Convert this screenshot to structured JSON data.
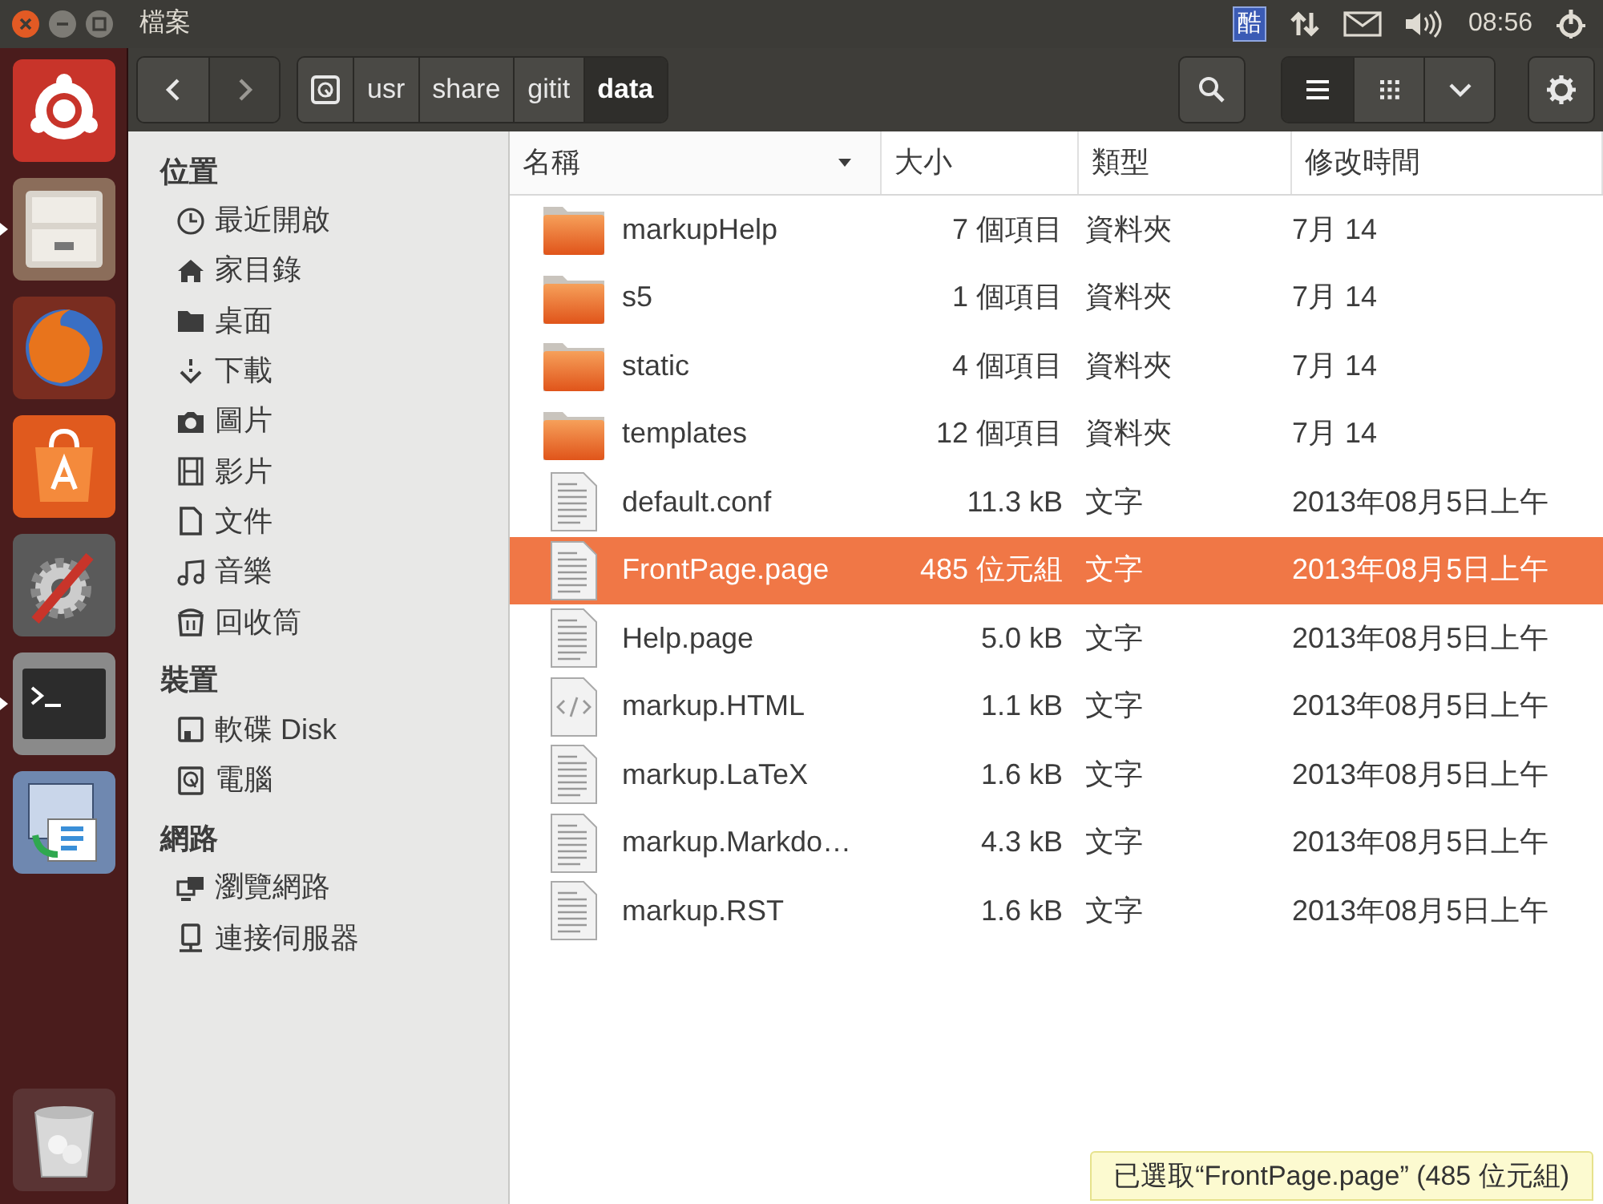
{
  "window": {
    "title": "檔案"
  },
  "indicators": {
    "keyboard": "酷",
    "time": "08:56"
  },
  "launcher": [
    {
      "running": false
    },
    {
      "running": true
    },
    {
      "running": false
    },
    {
      "running": false
    },
    {
      "running": false
    },
    {
      "running": true
    },
    {
      "running": false
    }
  ],
  "path": [
    {
      "label": "usr",
      "selected": false
    },
    {
      "label": "share",
      "selected": false
    },
    {
      "label": "gitit",
      "selected": false
    },
    {
      "label": "data",
      "selected": true
    }
  ],
  "sidebar": [
    {
      "heading": "位置",
      "items": [
        "最近開啟",
        "家目錄",
        "桌面",
        "下載",
        "圖片",
        "影片",
        "文件",
        "音樂",
        "回收筒"
      ]
    },
    {
      "heading": "裝置",
      "items": [
        "軟碟 Disk",
        "電腦"
      ]
    },
    {
      "heading": "網路",
      "items": [
        "瀏覽網路",
        "連接伺服器"
      ]
    }
  ],
  "columns": [
    {
      "label": "名稱",
      "sorted": true
    },
    {
      "label": "大小",
      "sorted": false
    },
    {
      "label": "類型",
      "sorted": false
    },
    {
      "label": "修改時間",
      "sorted": false
    }
  ],
  "rows": [
    {
      "kind": "folder",
      "name": "markupHelp",
      "size": "7 個項目",
      "type": "資料夾",
      "modified": "7月 14",
      "selected": false
    },
    {
      "kind": "folder",
      "name": "s5",
      "size": "1 個項目",
      "type": "資料夾",
      "modified": "7月 14",
      "selected": false
    },
    {
      "kind": "folder",
      "name": "static",
      "size": "4 個項目",
      "type": "資料夾",
      "modified": "7月 14",
      "selected": false
    },
    {
      "kind": "folder",
      "name": "templates",
      "size": "12 個項目",
      "type": "資料夾",
      "modified": "7月 14",
      "selected": false
    },
    {
      "kind": "text",
      "name": "default.conf",
      "size": "11.3 kB",
      "type": "文字",
      "modified": "2013年08月5日上午",
      "selected": false
    },
    {
      "kind": "text",
      "name": "FrontPage.page",
      "size": "485 位元組",
      "type": "文字",
      "modified": "2013年08月5日上午",
      "selected": true
    },
    {
      "kind": "text",
      "name": "Help.page",
      "size": "5.0 kB",
      "type": "文字",
      "modified": "2013年08月5日上午",
      "selected": false
    },
    {
      "kind": "html",
      "name": "markup.HTML",
      "size": "1.1 kB",
      "type": "文字",
      "modified": "2013年08月5日上午",
      "selected": false
    },
    {
      "kind": "text",
      "name": "markup.LaTeX",
      "size": "1.6 kB",
      "type": "文字",
      "modified": "2013年08月5日上午",
      "selected": false
    },
    {
      "kind": "text",
      "name": "markup.Markdo…",
      "size": "4.3 kB",
      "type": "文字",
      "modified": "2013年08月5日上午",
      "selected": false
    },
    {
      "kind": "text",
      "name": "markup.RST",
      "size": "1.6 kB",
      "type": "文字",
      "modified": "2013年08月5日上午",
      "selected": false
    }
  ],
  "status_bar": "已選取“FrontPage.page” (485 位元組)"
}
